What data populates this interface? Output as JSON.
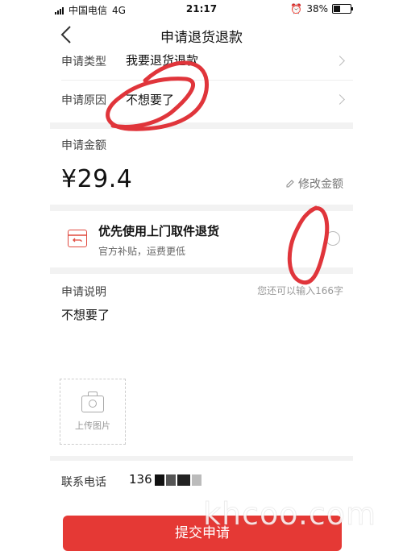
{
  "status_bar": {
    "carrier": "中国电信",
    "network": "4G",
    "time": "21:17",
    "battery": "38%",
    "battery_level": 0.38
  },
  "nav": {
    "title": "申请退货退款"
  },
  "rows": [
    {
      "label": "申请类型",
      "value": "我要退货退款"
    },
    {
      "label": "申请原因",
      "value": "不想要了"
    }
  ],
  "amount": {
    "label": "申请金额",
    "value": "¥29.4",
    "edit_label": "修改金额"
  },
  "pickup": {
    "title": "优先使用上门取件退货",
    "subtitle": "官方补贴，运费更低"
  },
  "description": {
    "label": "申请说明",
    "hint": "您还可以输入166字",
    "text": "不想要了"
  },
  "upload": {
    "label": "上传图片"
  },
  "phone": {
    "label": "联系电话",
    "value": "136"
  },
  "submit": {
    "label": "提交申请"
  },
  "watermark": "khcoo.com",
  "colors": {
    "accent": "#e53935",
    "scribble": "#e0353b"
  }
}
